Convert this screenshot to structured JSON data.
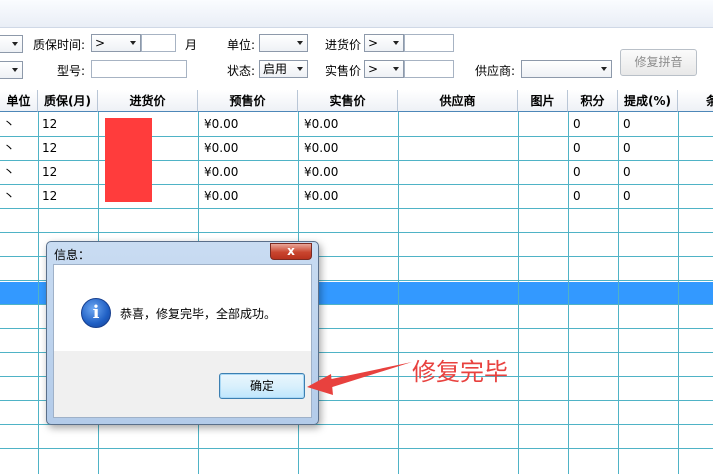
{
  "filters": {
    "warranty_label": "质保时间:",
    "warranty_op": ">",
    "warranty_unit": "月",
    "unit_label": "单位:",
    "unit_value": "",
    "purchase_label": "进货价",
    "purchase_op": ">",
    "model_label": "型号:",
    "status_label": "状态:",
    "status_value": "启用",
    "sale_label": "实售价",
    "sale_op": ">",
    "supplier_label": "供应商:",
    "supplier_value": "",
    "fix_button": "修复拼音"
  },
  "table": {
    "columns": [
      "单位",
      "质保(月)",
      "进货价",
      "预售价",
      "实售价",
      "供应商",
      "图片",
      "积分",
      "提成(%)",
      "条"
    ],
    "rows": [
      {
        "unit": "丶",
        "warranty": "12",
        "presale": "¥0.00",
        "sale": "¥0.00",
        "points": "0",
        "commission": "0"
      },
      {
        "unit": "丶",
        "warranty": "12",
        "presale": "¥0.00",
        "sale": "¥0.00",
        "points": "0",
        "commission": "0"
      },
      {
        "unit": "丶",
        "warranty": "12",
        "presale": "¥0.00",
        "sale": "¥0.00",
        "points": "0",
        "commission": "0"
      },
      {
        "unit": "丶",
        "warranty": "12",
        "presale": "¥0.00",
        "sale": "¥0.00",
        "points": "0",
        "commission": "0"
      }
    ]
  },
  "dialog": {
    "title": "信息：",
    "close": "x",
    "message": "恭喜，修复完毕，全部成功。",
    "ok_button": "确定",
    "icon": "info-icon"
  },
  "annotation": {
    "text": "修复完毕",
    "color": "#e8413e"
  },
  "colors": {
    "grid_line": "#4fb3c6",
    "selected_row": "#3399ff",
    "redacted": "#ff3c3c"
  }
}
